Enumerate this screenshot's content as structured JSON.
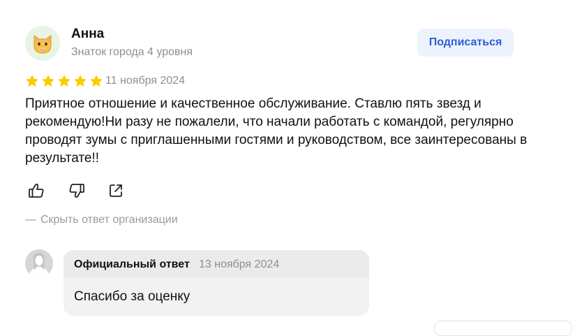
{
  "review": {
    "author": {
      "name": "Анна",
      "level": "Знаток города 4 уровня",
      "avatar_icon": "cat-face-emoji"
    },
    "subscribe_label": "Подписаться",
    "rating": 5,
    "rating_max": 5,
    "date": "11 ноября 2024",
    "text": "Приятное отношение и качественное обслуживание. Ставлю пять звезд и рекомендую!Ни разу не пожалели, что начали работать с командой, регулярно проводят зумы с приглашенными гостями и руководством, все заинтересованы в результате!!",
    "actions": [
      "thumbs-up-icon",
      "thumbs-down-icon",
      "share-icon"
    ]
  },
  "org_reply": {
    "toggle_dash": "—",
    "toggle_label": "Скрыть ответ организации",
    "label": "Официальный ответ",
    "date": "13 ноября 2024",
    "text": "Спасибо за оценку",
    "avatar_icon": "org-avatar-placeholder"
  },
  "colors": {
    "accent": "#2b5fd9",
    "star": "#fccc00",
    "muted": "#8f8f8f",
    "subscribe_bg": "#edf3fd"
  }
}
